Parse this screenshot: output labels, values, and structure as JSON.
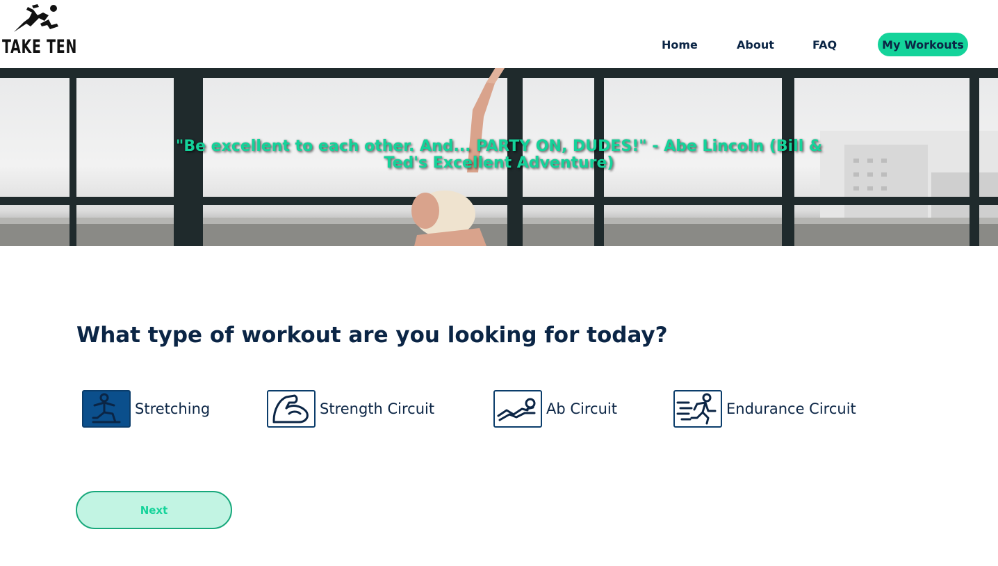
{
  "brand": {
    "name": "TAKE TEN",
    "accent": "#14d39a",
    "navy": "#0b2545"
  },
  "nav": {
    "home": "Home",
    "about": "About",
    "faq": "FAQ",
    "my_workouts": "My Workouts"
  },
  "hero": {
    "quote": "\"Be excellent to each other. And... PARTY ON, DUDES!\" - Abe Lincoln (Bill & Ted's Excellent Adventure)"
  },
  "main": {
    "question": "What type of workout are you looking for today?",
    "options": [
      {
        "label": "Stretching",
        "icon": "stretching-icon",
        "selected": true
      },
      {
        "label": "Strength Circuit",
        "icon": "flexed-arm-icon",
        "selected": false
      },
      {
        "label": "Ab Circuit",
        "icon": "situp-icon",
        "selected": false
      },
      {
        "label": "Endurance Circuit",
        "icon": "running-person-icon",
        "selected": false
      }
    ],
    "next_label": "Next"
  }
}
